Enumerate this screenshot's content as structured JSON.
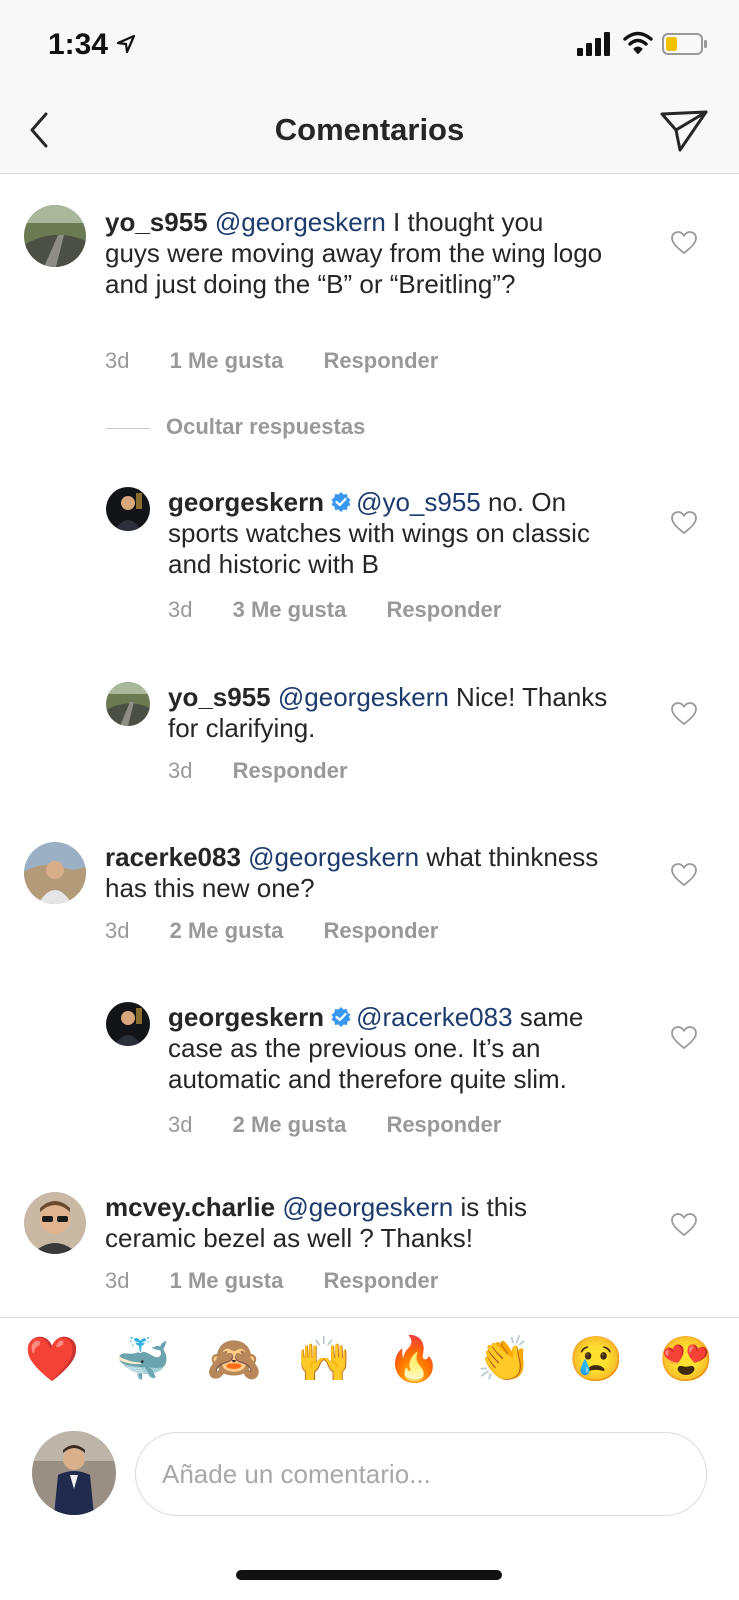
{
  "status_bar": {
    "time": "1:34"
  },
  "nav": {
    "title": "Comentarios"
  },
  "comments": [
    {
      "username": "yo_s955",
      "mention": "@georgeskern",
      "text": " I thought you guys were moving away from the wing logo and just doing the “B” or “Breitling”?",
      "age": "3d",
      "likes": "1 Me gusta",
      "reply": "Responder"
    },
    {
      "username": "georgeskern",
      "mention": "@yo_s955",
      "text": " no. On sports watches with wings on classic and historic with B",
      "age": "3d",
      "likes": "3 Me gusta",
      "reply": "Responder"
    },
    {
      "username": "yo_s955",
      "mention": "@georgeskern",
      "text": " Nice! Thanks for clarifying.",
      "age": "3d",
      "reply": "Responder"
    },
    {
      "username": "racerke083",
      "mention": "@georgeskern",
      "text": " what thinkness has this new one?",
      "age": "3d",
      "likes": "2 Me gusta",
      "reply": "Responder"
    },
    {
      "username": "georgeskern",
      "mention": "@racerke083",
      "text": " same case as the previous one. It’s an automatic and therefore quite slim.",
      "age": "3d",
      "likes": "2 Me gusta",
      "reply": "Responder"
    },
    {
      "username": "mcvey.charlie",
      "mention": "@georgeskern",
      "text": " is this ceramic bezel as well ? Thanks!",
      "age": "3d",
      "likes": "1 Me gusta",
      "reply": "Responder"
    }
  ],
  "hide_replies_label": "Ocultar respuestas",
  "emoji_bar": [
    "❤️",
    "🐳",
    "🙈",
    "🙌",
    "🔥",
    "👏",
    "😢",
    "😍"
  ],
  "composer": {
    "placeholder": "Añade un comentario..."
  },
  "colors": {
    "mention": "#1d3c6e",
    "meta": "#999999",
    "verified": "#3897f0",
    "heart_emoji": "#e0245e"
  },
  "icons": [
    "location-arrow-icon",
    "signal-icon",
    "wifi-icon",
    "battery-icon",
    "back-chevron-icon",
    "direct-send-icon",
    "heart-outline-icon",
    "verified-badge-icon"
  ]
}
